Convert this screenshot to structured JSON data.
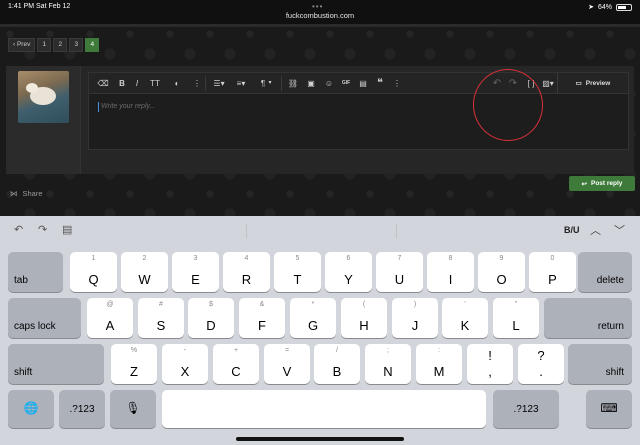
{
  "status_bar": {
    "time_date": "1:41 PM   Sat Feb 12",
    "url": "fuckcombustion.com",
    "battery": "64%",
    "battery_level": 0.64
  },
  "pager": {
    "prev": "‹ Prev",
    "pages": [
      "1",
      "2",
      "3",
      "4"
    ],
    "active_page": "4"
  },
  "editor": {
    "placeholder": "Write your reply...",
    "preview_label": "Preview",
    "toolbar_icons": [
      "eraser-icon",
      "bold-icon",
      "italic-icon",
      "text-size-icon",
      "palette-icon",
      "more-icon",
      "list-icon",
      "align-icon",
      "paragraph-icon",
      "link-icon",
      "image-icon",
      "emoji-icon",
      "gif-icon",
      "media-icon",
      "quote-icon",
      "more-icon",
      "undo-icon",
      "redo-icon",
      "bbcode-icon",
      "drafts-icon"
    ],
    "toolbar_glyphs": {
      "bold": "B",
      "italic": "I",
      "text_size": "TT",
      "paragraph": "¶",
      "gif": "GIF",
      "quote": "❝",
      "more": "⋮",
      "bbcode": "[ ]"
    }
  },
  "post_reply_label": "Post reply",
  "share_label": "Share",
  "annotation": {
    "color": "#d8323a"
  },
  "keyboard": {
    "biu": "B/U",
    "rows": [
      {
        "keys": [
          {
            "main": "tab"
          },
          {
            "alt": "1",
            "main": "Q"
          },
          {
            "alt": "2",
            "main": "W"
          },
          {
            "alt": "3",
            "main": "E"
          },
          {
            "alt": "4",
            "main": "R"
          },
          {
            "alt": "5",
            "main": "T"
          },
          {
            "alt": "6",
            "main": "Y"
          },
          {
            "alt": "7",
            "main": "U"
          },
          {
            "alt": "8",
            "main": "I"
          },
          {
            "alt": "9",
            "main": "O"
          },
          {
            "alt": "0",
            "main": "P"
          },
          {
            "main": "delete"
          }
        ]
      },
      {
        "keys": [
          {
            "main": "caps lock"
          },
          {
            "alt": "@",
            "main": "A"
          },
          {
            "alt": "#",
            "main": "S"
          },
          {
            "alt": "$",
            "main": "D"
          },
          {
            "alt": "&",
            "main": "F"
          },
          {
            "alt": "*",
            "main": "G"
          },
          {
            "alt": "(",
            "main": "H"
          },
          {
            "alt": ")",
            "main": "J"
          },
          {
            "alt": "'",
            "main": "K"
          },
          {
            "alt": "\"",
            "main": "L"
          },
          {
            "main": "return"
          }
        ]
      },
      {
        "keys": [
          {
            "main": "shift"
          },
          {
            "alt": "%",
            "main": "Z"
          },
          {
            "alt": "-",
            "main": "X"
          },
          {
            "alt": "+",
            "main": "C"
          },
          {
            "alt": "=",
            "main": "V"
          },
          {
            "alt": "/",
            "main": "B"
          },
          {
            "alt": ";",
            "main": "N"
          },
          {
            "alt": ":",
            "main": "M"
          },
          {
            "alt": "!",
            "main": ","
          },
          {
            "alt": "?",
            "main": "."
          },
          {
            "main": "shift"
          }
        ]
      },
      {
        "keys": [
          {
            "main": "globe-icon"
          },
          {
            "main": ".?123"
          },
          {
            "main": "mic-icon"
          },
          {
            "main": ""
          },
          {
            "main": ".?123"
          },
          {
            "main": "keyboard-icon"
          }
        ]
      }
    ]
  }
}
